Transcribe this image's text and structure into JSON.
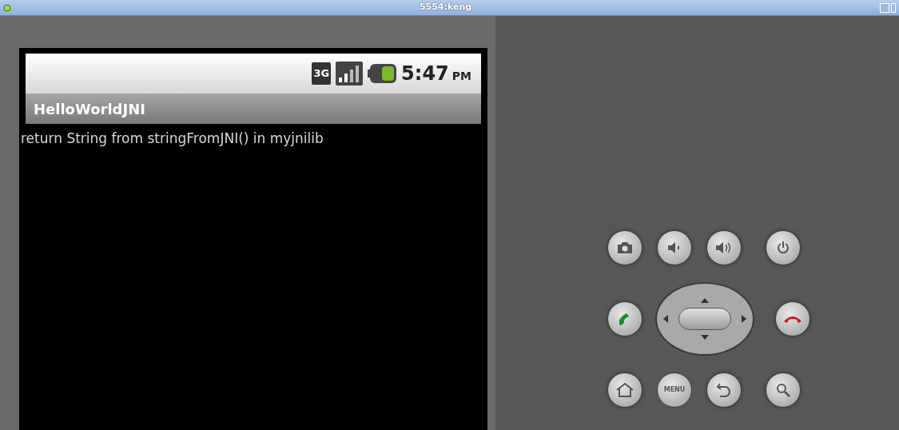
{
  "window": {
    "title": "5554:keng"
  },
  "status_bar": {
    "network": "3G",
    "time": "5:47",
    "ampm": "PM"
  },
  "app": {
    "title": "HelloWorldJNI",
    "message": "return String from stringFromJNI() in myjnilib"
  },
  "keys": {
    "menu_label": "MENU"
  }
}
